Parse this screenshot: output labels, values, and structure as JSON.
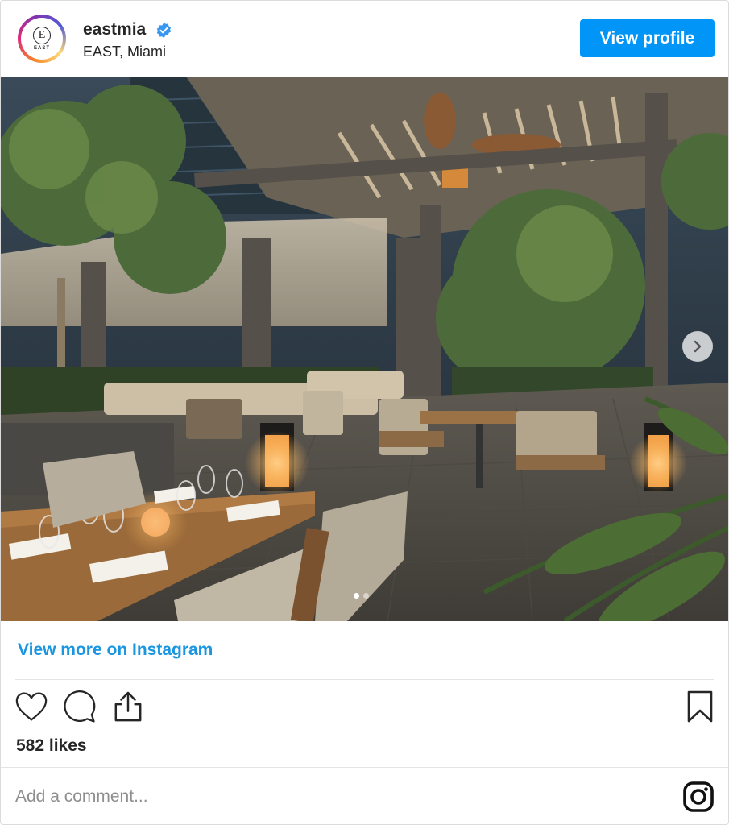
{
  "header": {
    "avatar_letter": "E",
    "avatar_text": "EAST",
    "username": "eastmia",
    "verified": true,
    "location": "EAST, Miami",
    "view_profile_label": "View profile"
  },
  "post": {
    "carousel_total": 2,
    "carousel_active_index": 0
  },
  "footer": {
    "view_more_label": "View more on Instagram",
    "likes_text": "582 likes",
    "comment_placeholder": "Add a comment..."
  },
  "icons": {
    "like": "heart-icon",
    "comment": "comment-bubble-icon",
    "share": "share-icon",
    "save": "bookmark-icon",
    "instagram": "instagram-logo-icon",
    "verified": "verified-badge-icon",
    "next": "chevron-right-icon"
  },
  "colors": {
    "accent": "#0095f6",
    "link": "#1a95e0",
    "text": "#262626",
    "muted": "#8e8e8e"
  }
}
